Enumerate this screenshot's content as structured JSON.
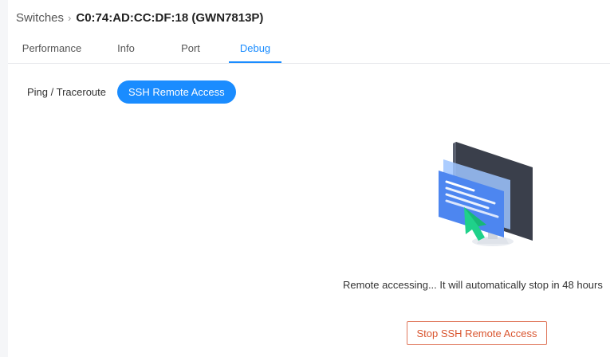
{
  "breadcrumb": {
    "parent": "Switches",
    "separator": "›",
    "current": "C0:74:AD:CC:DF:18 (GWN7813P)"
  },
  "tabs": [
    {
      "label": "Performance",
      "active": false
    },
    {
      "label": "Info",
      "active": false
    },
    {
      "label": "Port",
      "active": false
    },
    {
      "label": "Debug",
      "active": true
    }
  ],
  "subtabs": [
    {
      "label": "Ping / Traceroute",
      "active": false
    },
    {
      "label": "SSH Remote Access",
      "active": true
    }
  ],
  "main": {
    "illustration_icon": "monitor-remote-access-icon",
    "status_text": "Remote accessing... It will automatically stop in 48 hours",
    "stop_button_label": "Stop SSH Remote Access"
  },
  "colors": {
    "accent": "#1a8cff",
    "danger": "#d9552f",
    "arrow_green": "#1fd18a"
  }
}
